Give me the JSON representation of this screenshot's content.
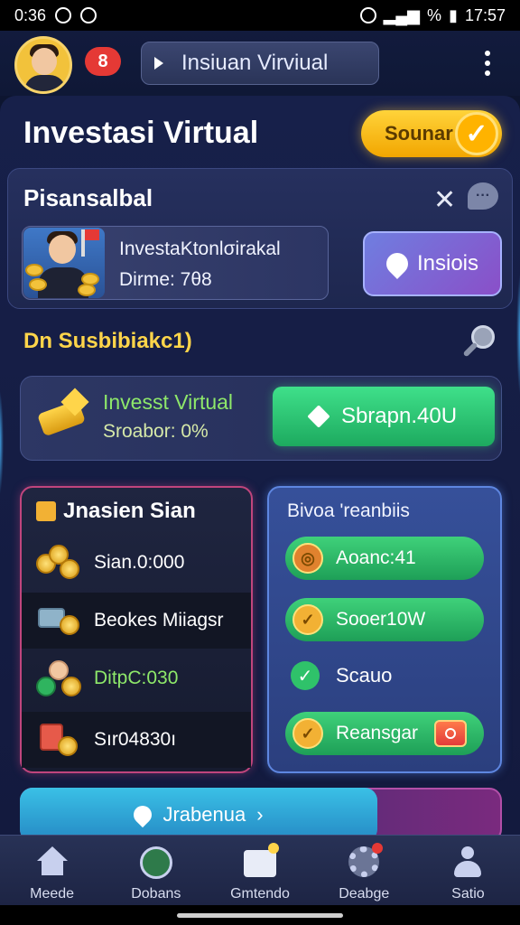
{
  "status_bar": {
    "time": "0:36",
    "clock": "17:57",
    "percent": "%"
  },
  "header": {
    "badge": "8",
    "search_text": "Insiuan Virviual"
  },
  "page": {
    "title": "Investasi Virtual",
    "action_button": "Sounar"
  },
  "card": {
    "title": "Pisansalbal",
    "item_line1": "InvestaKtonlσirakal",
    "item_line2": "Dirme: 7θ8",
    "side_button": "Insiois"
  },
  "section": {
    "title": "Dn Susbibiakc1)"
  },
  "invest_bar": {
    "line1": "Invesst Virtual",
    "line2": "Sroabor: 0%",
    "button": "Sbrapn.40U"
  },
  "left_panel": {
    "title": "Jnasien Sian",
    "rows": [
      {
        "label": "Sian.0:000",
        "icon": "coins-icon"
      },
      {
        "label": "Beokes Miiagsr",
        "icon": "wallet-icon"
      },
      {
        "label": "DitpC:030",
        "icon": "investor-icon"
      },
      {
        "label": "Sır04830ı",
        "icon": "document-icon"
      }
    ]
  },
  "right_panel": {
    "title": "Bivoa 'reanbiis",
    "items": [
      {
        "label": "Aoanc:41",
        "icon": "target-icon"
      },
      {
        "label": "Sooer10W",
        "icon": "coin-icon"
      },
      {
        "label": "Scauo",
        "icon": "check-icon"
      },
      {
        "label": "Reansgar",
        "icon": "coin-icon"
      }
    ]
  },
  "bottom_button": "Jrabenua",
  "nav": [
    {
      "label": "Meede",
      "icon": "home-icon"
    },
    {
      "label": "Dobans",
      "icon": "clock-icon"
    },
    {
      "label": "Gmtendo",
      "icon": "board-icon"
    },
    {
      "label": "Deabge",
      "icon": "gear-icon"
    },
    {
      "label": "Satio",
      "icon": "person-icon"
    }
  ]
}
